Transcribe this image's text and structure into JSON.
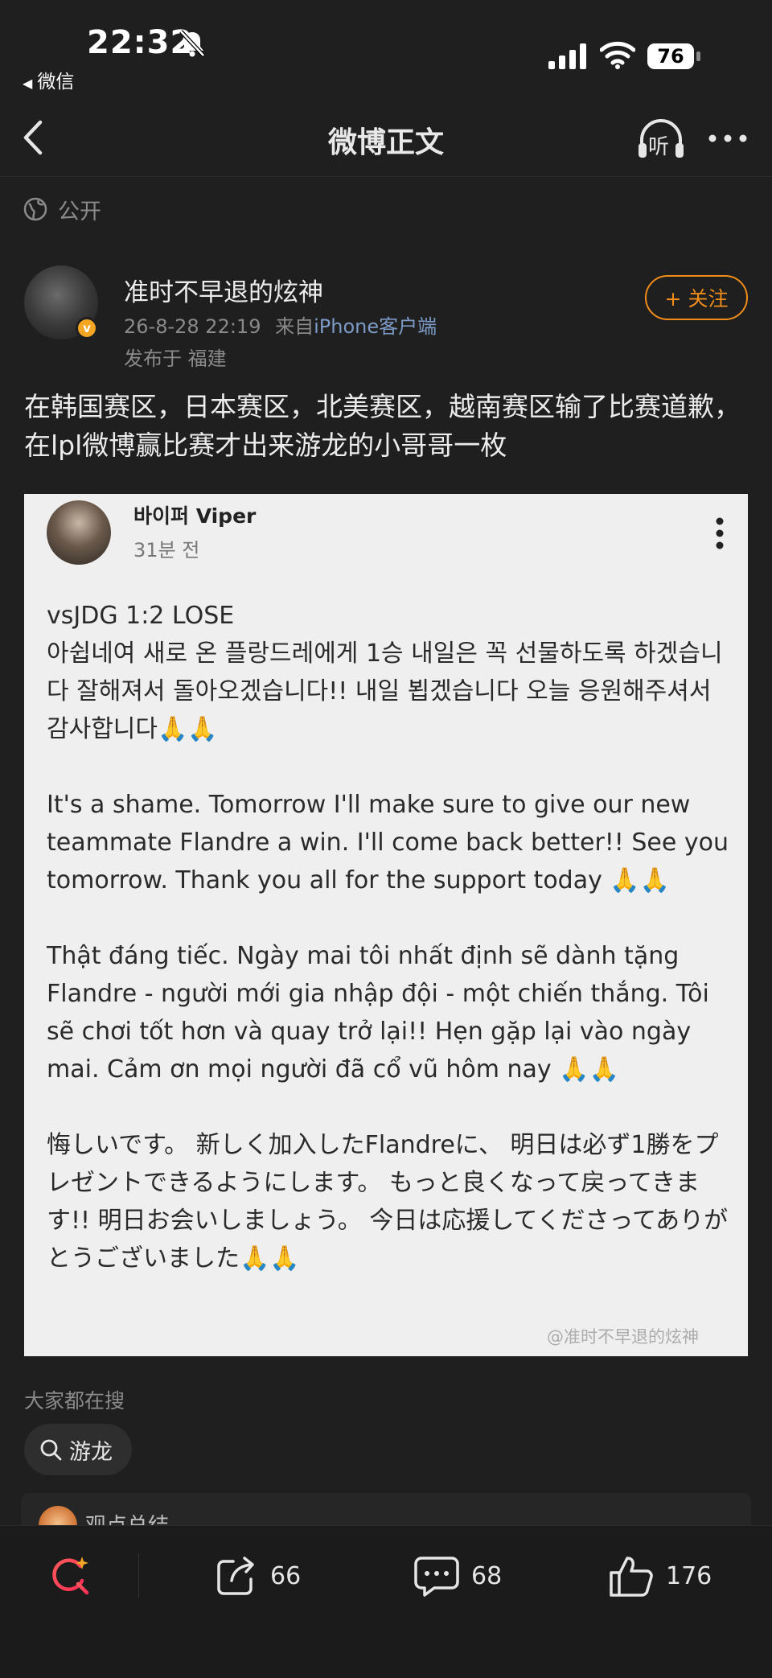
{
  "status_bar": {
    "time": "22:32",
    "back_app": "微信",
    "battery": "76"
  },
  "nav": {
    "title": "微博正文",
    "listen_label": "听"
  },
  "visibility": {
    "label": "公开"
  },
  "author": {
    "name": "准时不早退的炫神",
    "badge": "v",
    "date": "26-8-28 22:19",
    "source_prefix": "来自",
    "source": "iPhone客户端",
    "location": "发布于 福建",
    "follow_label": "+ 关注"
  },
  "post": {
    "text": "在韩国赛区，日本赛区，北美赛区，越南赛区输了比赛道歉，在lpl微博赢比赛才出来游龙的小哥哥一枚"
  },
  "embedded_image": {
    "name": "바이퍼 Viper",
    "time": "31분 전",
    "paragraphs": [
      "vsJDG 1:2 LOSE\n아쉽네여 새로 온 플랑드레에게 1승 내일은 꼭 선물하도록 하겠습니다 잘해져서 돌아오겠습니다!! 내일 뵙겠습니다 오늘 응원해주셔서 감사합니다🙏🙏",
      "It's a shame. Tomorrow I'll make sure to give our new teammate Flandre a win. I'll come back better!! See you tomorrow. Thank you all for the support today 🙏🙏",
      "Thật đáng tiếc. Ngày mai tôi nhất định sẽ dành tặng Flandre - người mới gia nhập đội - một chiến thắng. Tôi sẽ chơi tốt hơn và quay trở lại!! Hẹn gặp lại vào ngày mai. Cảm ơn mọi người đã cổ vũ hôm nay 🙏🙏",
      "悔しいです。 新しく加入したFlandreに、 明日は必ず1勝をプレゼントできるようにします。 もっと良くなって戻ってきます!! 明日お会いしましょう。 今日は応援してくださってありがとうございました🙏🙏"
    ],
    "watermark": "@准时不早退的炫神"
  },
  "hot_search": {
    "label": "大家都在搜",
    "chip": "游龙"
  },
  "summary": {
    "label": "观点总结"
  },
  "bottom_bar": {
    "repost_count": "66",
    "comment_count": "68",
    "like_count": "176"
  },
  "colors": {
    "background": "#1f1f1f",
    "accent_orange": "#f08d1a",
    "source_blue": "#7d9bc7",
    "badge_gold": "#f5a623"
  }
}
